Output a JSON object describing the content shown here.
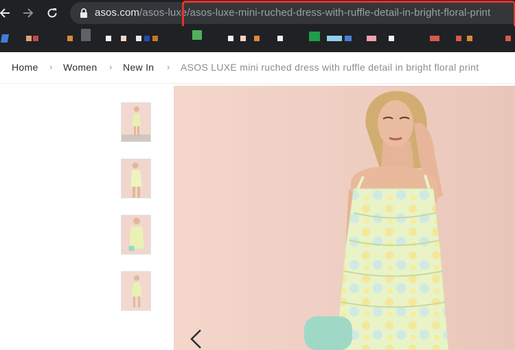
{
  "browser": {
    "url_host": "asos.com",
    "url_path": "/asos-luxe/asos-luxe-mini-ruched-dress-with-ruffle-detail-in-bright-floral-print",
    "back_icon": "arrow-left-icon",
    "forward_icon": "arrow-right-icon",
    "reload_icon": "reload-icon",
    "lock_icon": "lock-icon",
    "highlight_color": "#e8322b"
  },
  "breadcrumb": {
    "items": [
      "Home",
      "Women",
      "New In"
    ],
    "current": "ASOS LUXE mini ruched dress with ruffle detail in bright floral print",
    "separator": "›"
  },
  "gallery": {
    "thumbnail_count": 4,
    "prev_icon": "chevron-left-icon"
  }
}
